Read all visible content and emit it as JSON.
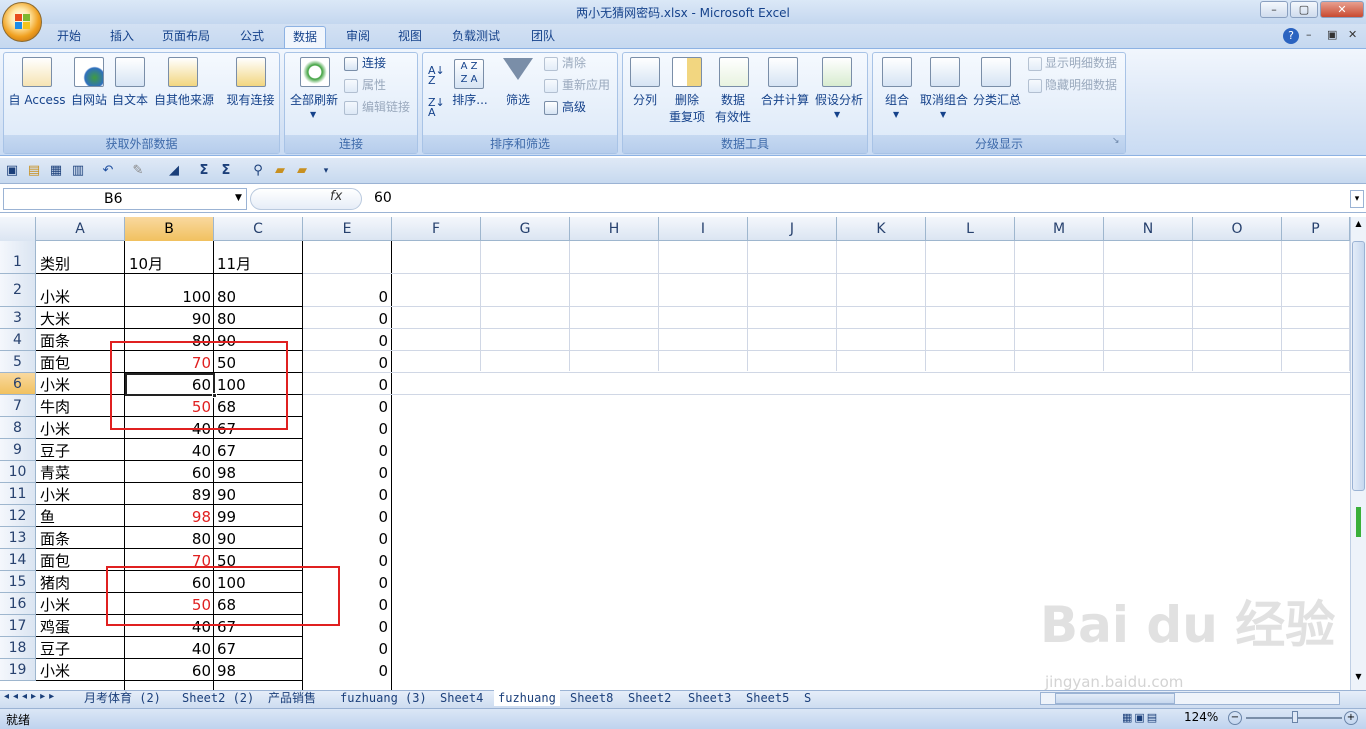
{
  "window": {
    "title": "两小无猜网密码.xlsx - Microsoft Excel"
  },
  "tabs": [
    "开始",
    "插入",
    "页面布局",
    "公式",
    "数据",
    "审阅",
    "视图",
    "负载测试",
    "团队"
  ],
  "active_tab": "数据",
  "ribbon": {
    "groups": [
      {
        "label": "获取外部数据",
        "buttons": [
          "自 Access",
          "自网站",
          "自文本",
          "自其他来源",
          "现有连接"
        ]
      },
      {
        "label": "连接",
        "buttons": [
          "全部刷新",
          "连接",
          "属性",
          "编辑链接"
        ]
      },
      {
        "label": "排序和筛选",
        "buttons": [
          "排序...",
          "筛选",
          "清除",
          "重新应用",
          "高级"
        ]
      },
      {
        "label": "数据工具",
        "buttons": [
          "分列",
          "删除",
          "重复项",
          "数据",
          "有效性",
          "合并计算",
          "假设分析"
        ]
      },
      {
        "label": "分级显示",
        "buttons": [
          "组合",
          "取消组合",
          "分类汇总",
          "显示明细数据",
          "隐藏明细数据"
        ]
      }
    ]
  },
  "formula_bar": {
    "name_box": "B6",
    "fx": "fx",
    "value": "60"
  },
  "columns": [
    "A",
    "B",
    "C",
    "E",
    "F",
    "G",
    "H",
    "I",
    "J",
    "K",
    "L",
    "M",
    "N",
    "O",
    "P"
  ],
  "rows": [
    {
      "n": "1",
      "a": "类别",
      "b": "10月",
      "c": "11月",
      "e": "",
      "b_red": false
    },
    {
      "n": "2",
      "a": "小米",
      "b": "100",
      "c": "80",
      "e": "0",
      "b_red": false
    },
    {
      "n": "3",
      "a": "大米",
      "b": "90",
      "c": "80",
      "e": "0",
      "b_red": false
    },
    {
      "n": "4",
      "a": "面条",
      "b": "80",
      "c": "90",
      "e": "0",
      "b_red": false
    },
    {
      "n": "5",
      "a": "面包",
      "b": "70",
      "c": "50",
      "e": "0",
      "b_red": true
    },
    {
      "n": "6",
      "a": "小米",
      "b": "60",
      "c": "100",
      "e": "0",
      "b_red": false
    },
    {
      "n": "7",
      "a": "牛肉",
      "b": "50",
      "c": "68",
      "e": "0",
      "b_red": true
    },
    {
      "n": "8",
      "a": "小米",
      "b": "40",
      "c": "67",
      "e": "0",
      "b_red": false
    },
    {
      "n": "9",
      "a": "豆子",
      "b": "40",
      "c": "67",
      "e": "0",
      "b_red": false
    },
    {
      "n": "10",
      "a": "青菜",
      "b": "60",
      "c": "98",
      "e": "0",
      "b_red": false
    },
    {
      "n": "11",
      "a": "小米",
      "b": "89",
      "c": "90",
      "e": "0",
      "b_red": false
    },
    {
      "n": "12",
      "a": "鱼",
      "b": "98",
      "c": "99",
      "e": "0",
      "b_red": true
    },
    {
      "n": "13",
      "a": "面条",
      "b": "80",
      "c": "90",
      "e": "0",
      "b_red": false
    },
    {
      "n": "14",
      "a": "面包",
      "b": "70",
      "c": "50",
      "e": "0",
      "b_red": true
    },
    {
      "n": "15",
      "a": "猪肉",
      "b": "60",
      "c": "100",
      "e": "0",
      "b_red": false
    },
    {
      "n": "16",
      "a": "小米",
      "b": "50",
      "c": "68",
      "e": "0",
      "b_red": true
    },
    {
      "n": "17",
      "a": "鸡蛋",
      "b": "40",
      "c": "67",
      "e": "0",
      "b_red": false
    },
    {
      "n": "18",
      "a": "豆子",
      "b": "40",
      "c": "67",
      "e": "0",
      "b_red": false
    },
    {
      "n": "19",
      "a": "小米",
      "b": "60",
      "c": "98",
      "e": "0",
      "b_red": false
    }
  ],
  "sheets": [
    "月考体育 (2)",
    "Sheet2 (2)",
    "产品销售",
    "fuzhuang (3)",
    "Sheet4",
    "fuzhuang",
    "Sheet8",
    "Sheet2",
    "Sheet3",
    "Sheet5",
    "S"
  ],
  "active_sheet": "fuzhuang",
  "status": {
    "mode": "就绪",
    "zoom": "124%"
  },
  "watermark": {
    "brand": "Bai du 经验",
    "url": "jingyan.baidu.com"
  },
  "colors": {
    "highlight_box": "#e02020",
    "red_text": "#e02020"
  }
}
